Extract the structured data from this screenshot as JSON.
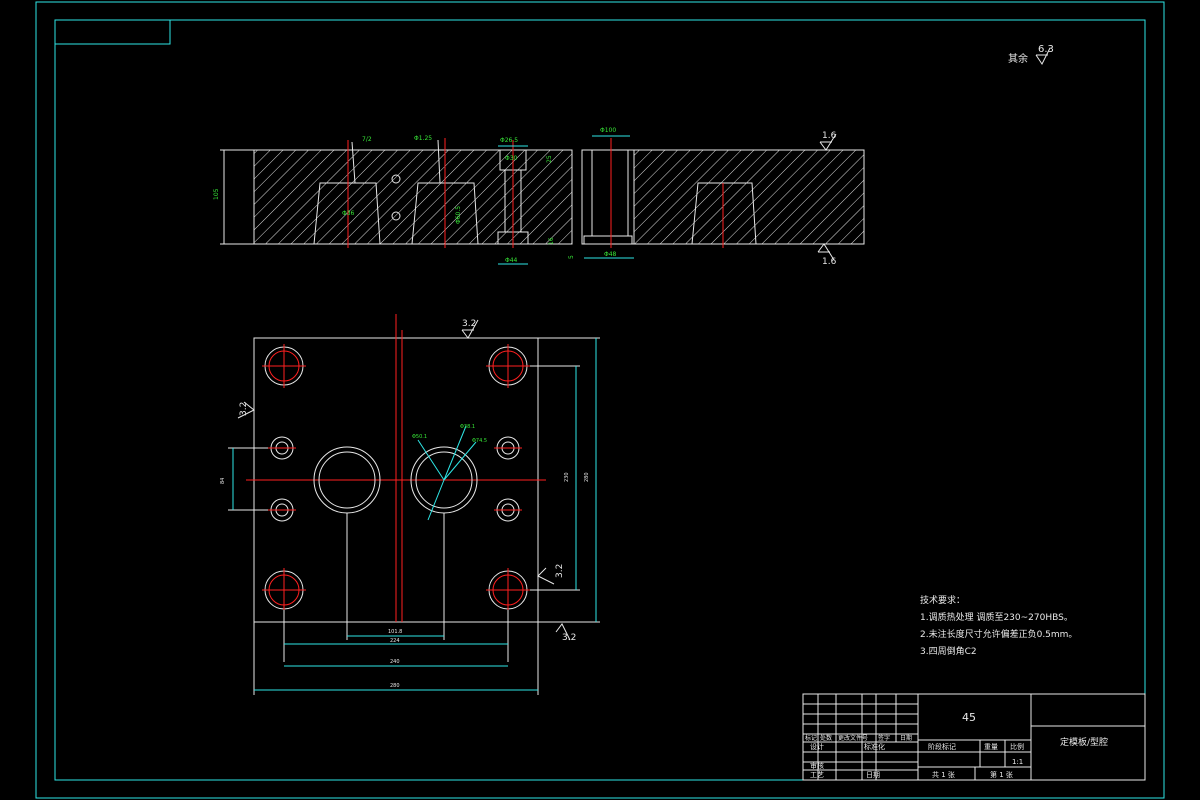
{
  "roughness": {
    "general_label": "其余",
    "general_value": "6.3",
    "top_face": "1.6",
    "bottom_face": "1.6",
    "plan_top": "3.2",
    "plan_left": "3.2",
    "plan_right": "3.2",
    "plan_bottom": "3.2"
  },
  "section_dims": {
    "d1": "7/2",
    "d2": "Φ1.25",
    "d3": "Φ26.5",
    "d4": "Φ30",
    "d5": "95",
    "d6": "Φ36",
    "d7": "Φ44",
    "d8": "16",
    "d9": "25",
    "d10": "5",
    "d11": "Φ3-1:5",
    "d12": "Φ60.5",
    "d13": "105",
    "d14": "8.5",
    "d15": "Φ100",
    "d16": "Φ48"
  },
  "plan_dims": {
    "phi_a": "Φ50.1",
    "phi_b": "Φ38.1",
    "phi_c": "Φ74.5",
    "w1": "101.8",
    "w2": "224",
    "w3": "240",
    "w4": "280",
    "h_small": "84",
    "h_mid": "230",
    "h_full": "280"
  },
  "tech_notes": {
    "heading": "技术要求：",
    "lines": [
      "1.调质热处理  调质至230~270HBS。",
      "2.未注长度尺寸允许偏差正负0.5mm。",
      "3.四周倒角C2"
    ]
  },
  "title_block": {
    "material": "45",
    "part_name": "定模板/型腔",
    "row_labels": [
      "标记",
      "处数",
      "更改文件号",
      "签字",
      "日期"
    ],
    "design": "设计",
    "standardize": "标准化",
    "stage_mark": "阶段标记",
    "weight": "重量",
    "scale": "比例",
    "scale_value": "1:1",
    "check": "审核",
    "process": "工艺",
    "approve": "日期",
    "sheets_total": "共 1 张",
    "sheet_no": "第 1 张"
  }
}
